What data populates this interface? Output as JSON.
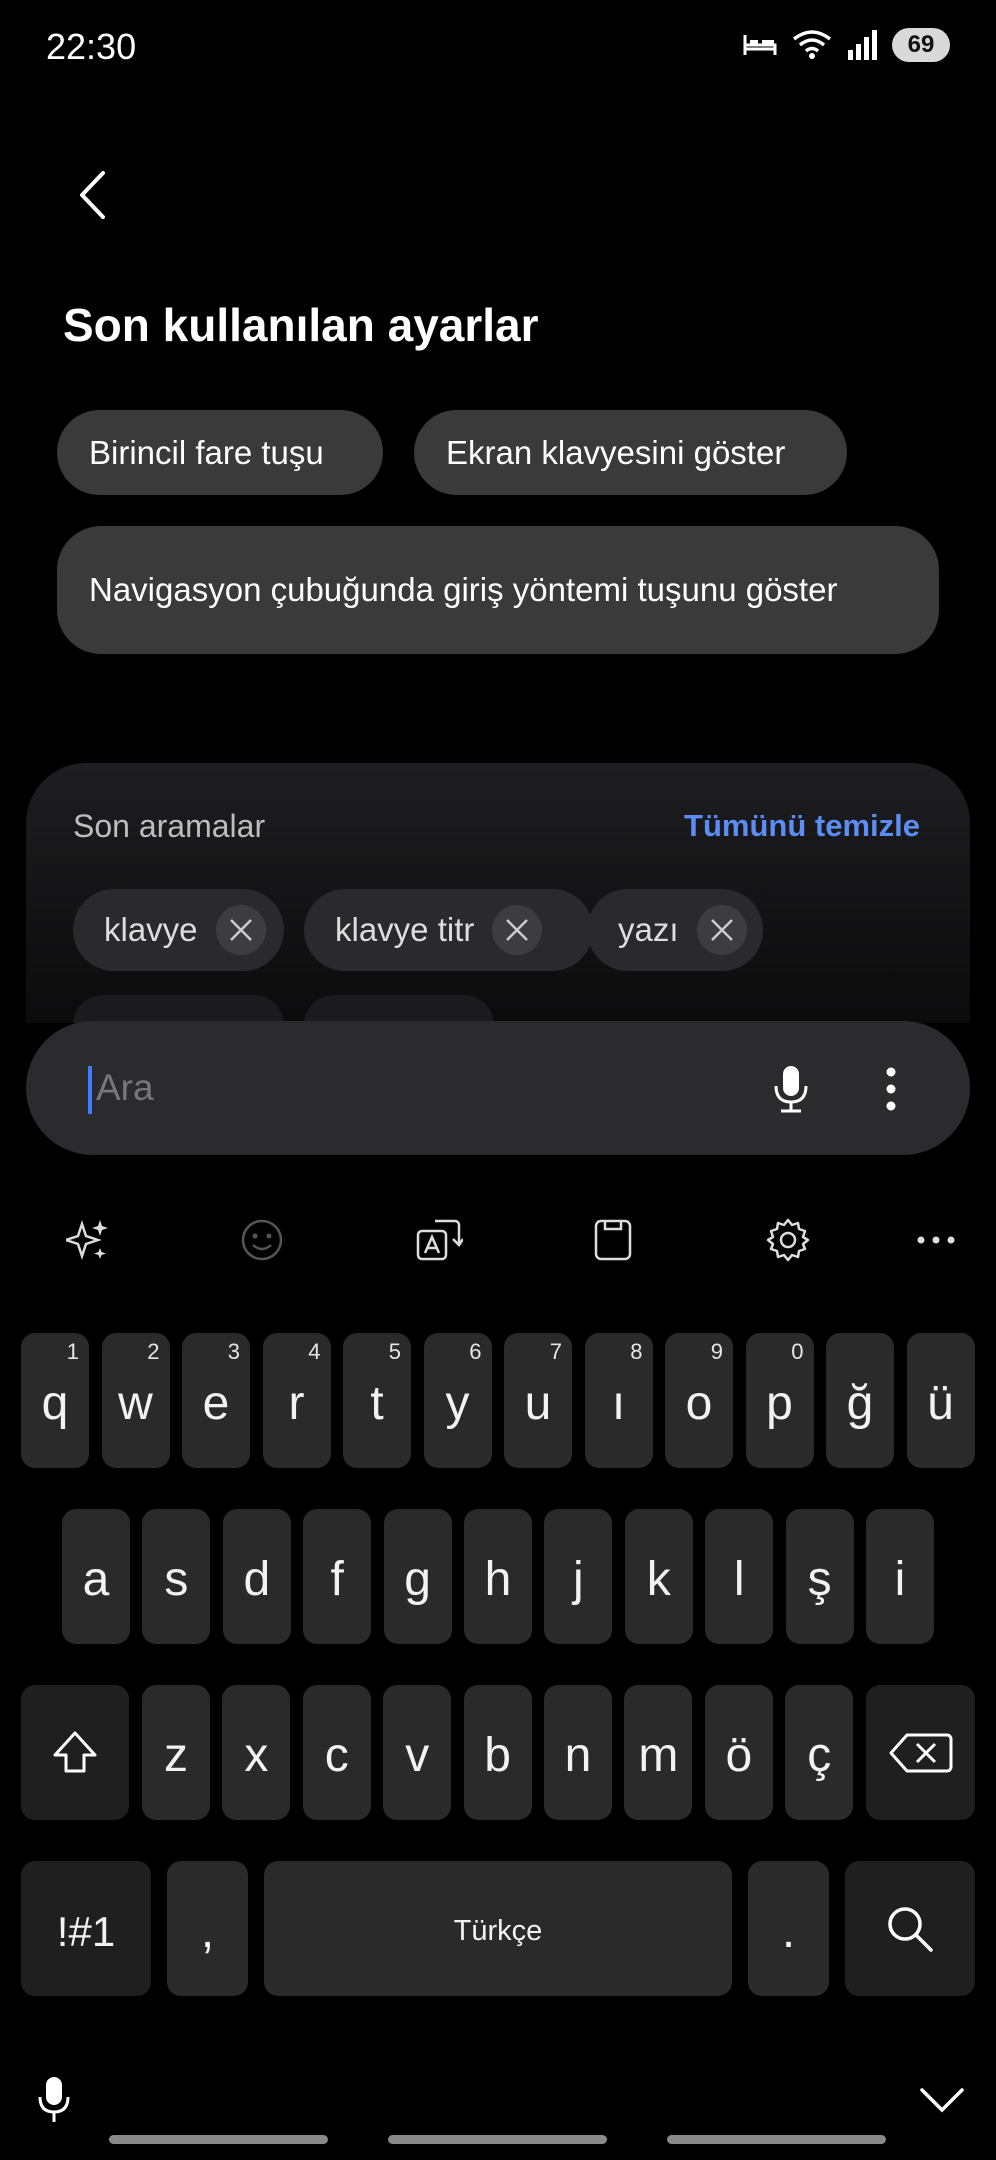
{
  "status_bar": {
    "time": "22:30",
    "battery": "69"
  },
  "page": {
    "section_title": "Son kullanılan ayarlar",
    "recent_settings": [
      "Birincil fare tuşu",
      "Ekran klavyesini göster",
      "Navigasyon çubuğunda giriş yöntemi tuşunu göster"
    ]
  },
  "recent_searches": {
    "title": "Son aramalar",
    "clear_all": "Tümünü temizle",
    "items": [
      "klavye",
      "klavye titr",
      "yazı"
    ]
  },
  "search": {
    "placeholder": "Ara",
    "value": ""
  },
  "keyboard": {
    "row1": [
      {
        "key": "q",
        "num": "1"
      },
      {
        "key": "w",
        "num": "2"
      },
      {
        "key": "e",
        "num": "3"
      },
      {
        "key": "r",
        "num": "4"
      },
      {
        "key": "t",
        "num": "5"
      },
      {
        "key": "y",
        "num": "6"
      },
      {
        "key": "u",
        "num": "7"
      },
      {
        "key": "ı",
        "num": "8"
      },
      {
        "key": "o",
        "num": "9"
      },
      {
        "key": "p",
        "num": "0"
      },
      {
        "key": "ğ",
        "num": ""
      },
      {
        "key": "ü",
        "num": ""
      }
    ],
    "row2": [
      "a",
      "s",
      "d",
      "f",
      "g",
      "h",
      "j",
      "k",
      "l",
      "ş",
      "i"
    ],
    "row3": [
      "z",
      "x",
      "c",
      "v",
      "b",
      "n",
      "m",
      "ö",
      "ç"
    ],
    "symbols_label": "!#1",
    "comma": ",",
    "space_label": "Türkçe",
    "period": "."
  }
}
